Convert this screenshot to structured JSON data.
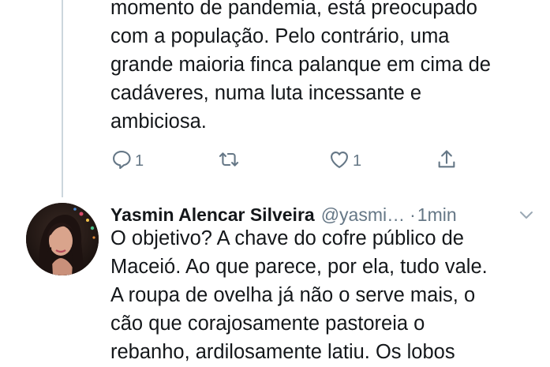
{
  "tweet1": {
    "text": "momento de pandemia, está preocupado\ncom a população. Pelo contrário, uma\ngrande maioria finca palanque em cima de\ncadáveres, numa luta incessante e\nambiciosa.",
    "reply_count": "1",
    "like_count": "1",
    "icons": [
      "reply-icon",
      "retweet-icon",
      "like-icon",
      "share-icon"
    ]
  },
  "tweet2": {
    "author_name": "Yasmin Alencar Silveira",
    "handle": "@yasmi…",
    "separator": "·",
    "time": "1min",
    "text": "O objetivo? A chave do cofre público de\nMaceió. Ao que parece, por ela, tudo vale.\nA roupa de ovelha já não o serve mais, o\ncão que corajosamente pastoreia o\nrebanho, ardilosamente latiu. Os lobos",
    "icons": [
      "avatar",
      "chevron-down-icon"
    ]
  },
  "colors": {
    "text": "#14171a",
    "secondary": "#657786",
    "thread_line": "#ccd6dd"
  }
}
